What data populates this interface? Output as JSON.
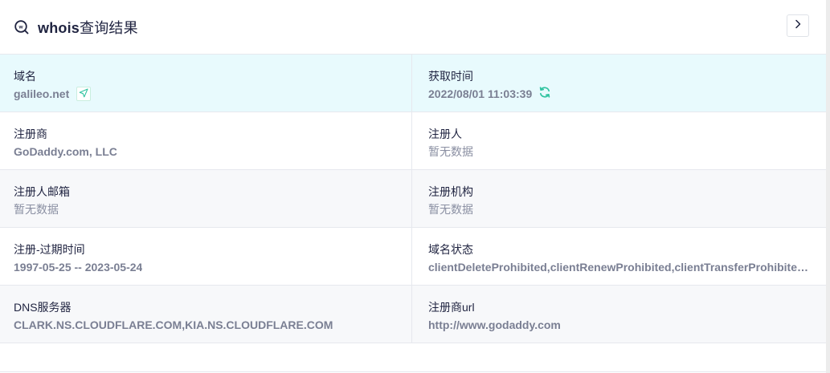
{
  "header": {
    "title_prefix": "whois",
    "title_suffix": "查询结果",
    "icon": "search-whois-icon",
    "expand_icon": "chevron-right-icon"
  },
  "colors": {
    "accent": "#2fc3a0",
    "highlight_row": "#e8fafd",
    "text_dark": "#1f2340",
    "text_muted": "#7a7f93"
  },
  "rows": [
    {
      "left": {
        "label": "域名",
        "value": "galileo.net"
      },
      "right": {
        "label": "获取时间",
        "value": "2022/08/01 11:03:39"
      }
    },
    {
      "left": {
        "label": "注册商",
        "value": "GoDaddy.com, LLC"
      },
      "right": {
        "label": "注册人",
        "value": "暂无数据"
      }
    },
    {
      "left": {
        "label": "注册人邮箱",
        "value": "暂无数据"
      },
      "right": {
        "label": "注册机构",
        "value": "暂无数据"
      }
    },
    {
      "left": {
        "label": "注册-过期时间",
        "value": "1997-05-25 -- 2023-05-24"
      },
      "right": {
        "label": "域名状态",
        "value": "clientDeleteProhibited,clientRenewProhibited,clientTransferProhibited,clientUpdateProhibited"
      }
    },
    {
      "left": {
        "label": "DNS服务器",
        "value": "CLARK.NS.CLOUDFLARE.COM,KIA.NS.CLOUDFLARE.COM"
      },
      "right": {
        "label": "注册商url",
        "value": "http://www.godaddy.com"
      }
    }
  ]
}
